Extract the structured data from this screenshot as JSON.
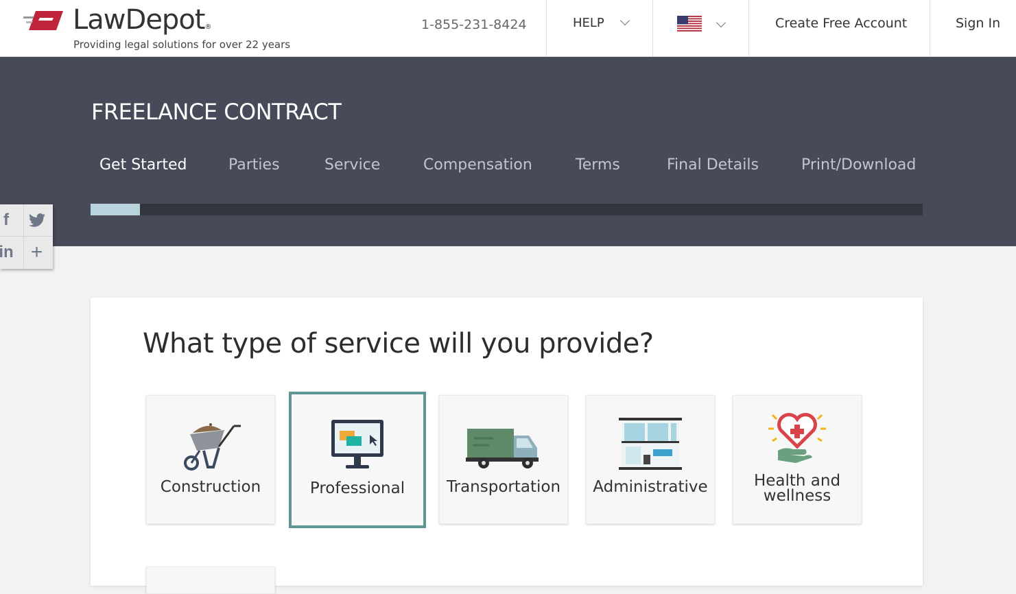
{
  "header": {
    "logo_name_bold": "Law",
    "logo_name_thin": "Depot",
    "logo_reg": "®",
    "logo_tagline": "Providing legal solutions for over 22 years",
    "phone": "1-855-231-8424",
    "help_label": "HELP",
    "create_account_label": "Create Free Account",
    "sign_in_label": "Sign In"
  },
  "banner": {
    "document_title": "FREELANCE CONTRACT",
    "steps": [
      {
        "label": "Get Started",
        "active": true
      },
      {
        "label": "Parties",
        "active": false
      },
      {
        "label": "Service",
        "active": false
      },
      {
        "label": "Compensation",
        "active": false
      },
      {
        "label": "Terms",
        "active": false
      },
      {
        "label": "Final Details",
        "active": false
      },
      {
        "label": "Print/Download",
        "active": false
      }
    ],
    "progress_fraction": 0.059
  },
  "social": [
    "facebook-icon",
    "twitter-icon",
    "linkedin-icon",
    "plus-icon"
  ],
  "question": {
    "text": "What type of service will you provide?",
    "options": [
      {
        "label": "Construction",
        "icon": "wheelbarrow-icon",
        "selected": false
      },
      {
        "label": "Professional",
        "icon": "computer-monitor-icon",
        "selected": true
      },
      {
        "label": "Transportation",
        "icon": "truck-icon",
        "selected": false
      },
      {
        "label": "Administrative",
        "icon": "office-building-icon",
        "selected": false
      },
      {
        "label_line1": "Health and",
        "label_line2": "wellness",
        "icon": "heart-hand-icon",
        "selected": false
      }
    ]
  },
  "colors": {
    "banner": "#474a58",
    "progress_fill": "#b9d3dc",
    "selected_border": "#5e9696",
    "logo_red": "#c0243a"
  }
}
